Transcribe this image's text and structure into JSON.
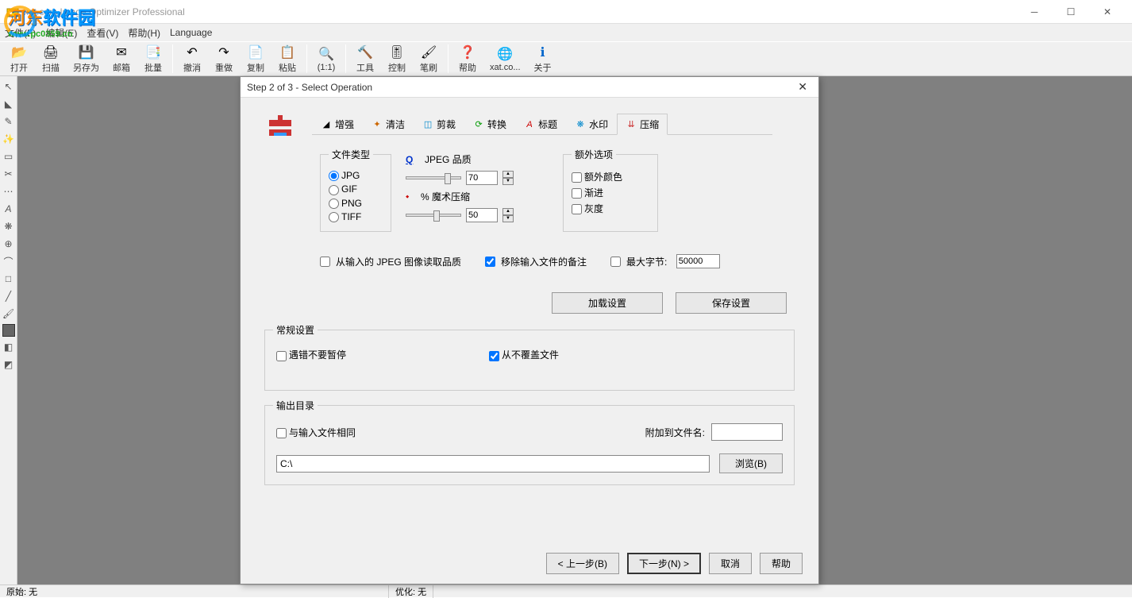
{
  "window": {
    "title": "xat.com  Image Optimizer Professional"
  },
  "watermark": {
    "text1": "河东",
    "text2": "软件园",
    "url": "www.pc0359.cn"
  },
  "menu": {
    "file": "文件(F)",
    "edit": "编辑(E)",
    "view": "查看(V)",
    "help": "帮助(H)",
    "language": "Language"
  },
  "toolbar": {
    "open": "打开",
    "scan": "扫描",
    "saveas": "另存为",
    "mail": "邮箱",
    "batch": "批量",
    "undo": "撤消",
    "redo": "重做",
    "copy": "复制",
    "paste": "粘贴",
    "zoom": "(1:1)",
    "tools": "工具",
    "control": "控制",
    "brush": "笔刷",
    "help": "帮助",
    "xat": "xat.co...",
    "about": "关于"
  },
  "statusbar": {
    "original": "原始: 无",
    "optimized": "优化: 无"
  },
  "dialog": {
    "title": "Step 2 of 3 - Select Operation",
    "tabs": {
      "enhance": "增强",
      "clean": "清洁",
      "crop": "剪裁",
      "convert": "转换",
      "title": "标题",
      "watermark": "水印",
      "compress": "压缩"
    },
    "filetype": {
      "legend": "文件类型",
      "jpg": "JPG",
      "gif": "GIF",
      "png": "PNG",
      "tiff": "TIFF"
    },
    "quality": {
      "jpeg_label": "JPEG 品质",
      "jpeg_value": "70",
      "magic_label": "% 魔术压缩",
      "magic_value": "50"
    },
    "extra": {
      "legend": "额外选项",
      "extra_color": "额外颜色",
      "progressive": "渐进",
      "grayscale": "灰度"
    },
    "checks": {
      "read_quality": "从输入的 JPEG 图像读取品质",
      "remove_comments": "移除输入文件的备注",
      "max_bytes_label": "最大字节:",
      "max_bytes_value": "50000"
    },
    "buttons": {
      "load_settings": "加载设置",
      "save_settings": "保存设置"
    },
    "general": {
      "legend": "常规设置",
      "no_pause": "遇错不要暂停",
      "no_overwrite": "从不覆盖文件"
    },
    "output": {
      "legend": "输出目录",
      "same_as_input": "与输入文件相同",
      "suffix_label": "附加到文件名:",
      "path": "C:\\",
      "browse": "浏览(B)"
    },
    "footer": {
      "back": "< 上一步(B)",
      "next": "下一步(N) >",
      "cancel": "取消",
      "help": "帮助"
    }
  }
}
